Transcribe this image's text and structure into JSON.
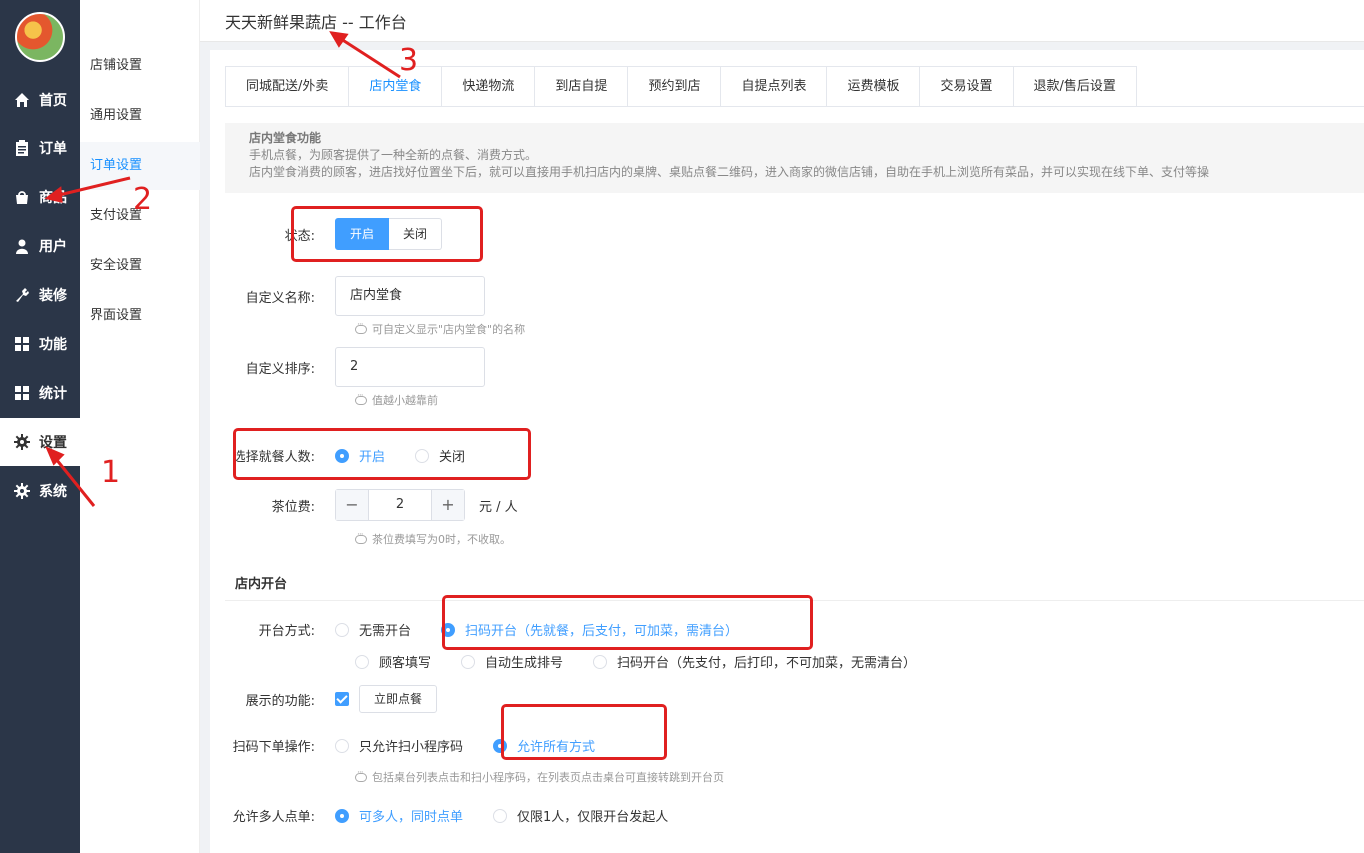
{
  "header": {
    "title": "天天新鲜果蔬店 -- 工作台"
  },
  "nav": {
    "items": [
      {
        "label": "首页",
        "icon": "home-icon"
      },
      {
        "label": "订单",
        "icon": "clipboard-icon"
      },
      {
        "label": "商品",
        "icon": "bag-icon"
      },
      {
        "label": "用户",
        "icon": "user-icon"
      },
      {
        "label": "装修",
        "icon": "wrench-icon"
      },
      {
        "label": "功能",
        "icon": "grid-icon"
      },
      {
        "label": "统计",
        "icon": "grid-icon"
      },
      {
        "label": "设置",
        "icon": "gear-icon"
      },
      {
        "label": "系统",
        "icon": "gear-icon"
      }
    ],
    "active": "设置"
  },
  "subnav": {
    "items": [
      "店铺设置",
      "通用设置",
      "订单设置",
      "支付设置",
      "安全设置",
      "界面设置"
    ],
    "active": "订单设置"
  },
  "tabs": [
    "同城配送/外卖",
    "店内堂食",
    "快递物流",
    "到店自提",
    "预约到店",
    "自提点列表",
    "运费模板",
    "交易设置",
    "退款/售后设置"
  ],
  "intro": {
    "heading": "店内堂食功能",
    "line1": "手机点餐，为顾客提供了一种全新的点餐、消费方式。",
    "line2": "店内堂食消费的顾客，进店找好位置坐下后，就可以直接用手机扫店内的桌牌、桌贴点餐二维码，进入商家的微信店铺，自助在手机上浏览所有菜品，并可以实现在线下单、支付等操"
  },
  "form": {
    "status": {
      "label": "状态:",
      "on": "开启",
      "off": "关闭"
    },
    "custom_name": {
      "label": "自定义名称:",
      "value": "店内堂食",
      "tip": "可自定义显示\"店内堂食\"的名称"
    },
    "custom_sort": {
      "label": "自定义排序:",
      "value": "2",
      "tip": "值越小越靠前"
    },
    "diners": {
      "label": "选择就餐人数:",
      "on": "开启",
      "off": "关闭"
    },
    "tea_fee": {
      "label": "茶位费:",
      "value": "2",
      "minus": "−",
      "plus": "+",
      "unit": "元 / 人",
      "tip": "茶位费填写为0时，不收取。"
    },
    "section": "店内开台",
    "open_mode": {
      "label": "开台方式:",
      "options": [
        "无需开台",
        "扫码开台（先就餐，后支付，可加菜，需清台）",
        "顾客填写",
        "自动生成排号",
        "扫码开台（先支付，后打印，不可加菜，无需清台）"
      ]
    },
    "features": {
      "label": "展示的功能:",
      "button": "立即点餐"
    },
    "scan_order": {
      "label": "扫码下单操作:",
      "opt1": "只允许扫小程序码",
      "opt2": "允许所有方式",
      "tip": "包括桌台列表点击和扫小程序码，在列表页点击桌台可直接转跳到开台页"
    },
    "multi": {
      "label": "允许多人点单:",
      "opt1": "可多人，同时点单",
      "opt2": "仅限1人，仅限开台发起人"
    }
  },
  "annotations": [
    "1",
    "2",
    "3"
  ],
  "colors": {
    "nav_bg": "#2b3648",
    "accent": "#409eff",
    "annotation": "#e02020"
  }
}
